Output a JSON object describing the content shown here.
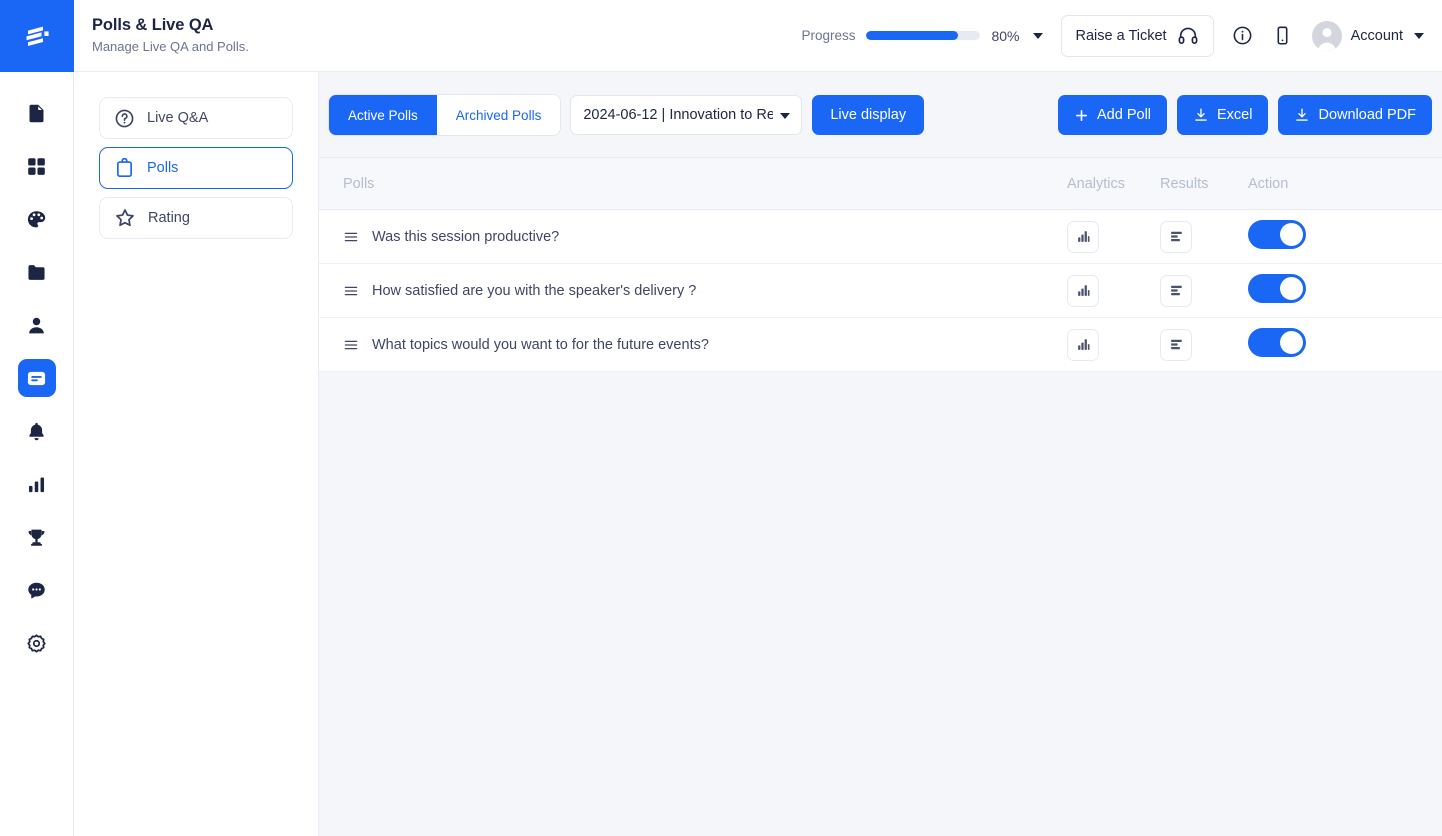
{
  "brand": {
    "logo_icon": "stacked-bars-logo",
    "accent_color": "#1a66f5"
  },
  "header": {
    "title": "Polls & Live QA",
    "subtitle": "Manage Live QA and Polls.",
    "progress": {
      "label": "Progress",
      "percent_text": "80%",
      "percent_value": 80,
      "caret_icon": "chevron-down-icon"
    },
    "raise_ticket": {
      "label": "Raise a Ticket",
      "icon": "headset-icon"
    },
    "info_icon": "info-circle-icon",
    "mobile_icon": "mobile-device-icon",
    "account": {
      "label": "Account",
      "avatar_icon": "user-avatar-icon",
      "caret_icon": "chevron-down-icon"
    }
  },
  "rail": {
    "items": [
      {
        "icon": "document-icon",
        "name": "document",
        "active": false
      },
      {
        "icon": "grid-icon",
        "name": "dashboard",
        "active": false
      },
      {
        "icon": "palette-icon",
        "name": "branding",
        "active": false
      },
      {
        "icon": "folder-icon",
        "name": "files",
        "active": false
      },
      {
        "icon": "user-icon",
        "name": "attendees",
        "active": false
      },
      {
        "icon": "polls-icon",
        "name": "polls",
        "active": true
      },
      {
        "icon": "bell-icon",
        "name": "notifications",
        "active": false
      },
      {
        "icon": "bar-chart-icon",
        "name": "analytics",
        "active": false
      },
      {
        "icon": "trophy-icon",
        "name": "gamification",
        "active": false
      },
      {
        "icon": "chat-icon",
        "name": "chat",
        "active": false
      },
      {
        "icon": "gear-icon",
        "name": "settings",
        "active": false
      }
    ]
  },
  "subnav": {
    "items": [
      {
        "label": "Live Q&A",
        "icon": "question-circle-icon",
        "active": false
      },
      {
        "label": "Polls",
        "icon": "clipboard-icon",
        "active": true
      },
      {
        "label": "Rating",
        "icon": "star-icon",
        "active": false
      }
    ]
  },
  "toolbar": {
    "tabs": [
      {
        "label": "Active Polls",
        "active": true
      },
      {
        "label": "Archived Polls",
        "active": false
      }
    ],
    "session_select": {
      "value": "2024-06-12 | Innovation to Re",
      "options": [
        "2024-06-12 | Innovation to Re"
      ]
    },
    "live_display_label": "Live display",
    "add_poll": {
      "label": "Add Poll",
      "icon": "plus-icon"
    },
    "excel": {
      "label": "Excel",
      "icon": "download-icon"
    },
    "download_pdf": {
      "label": "Download PDF",
      "icon": "download-icon"
    }
  },
  "table": {
    "columns": {
      "polls": "Polls",
      "analytics": "Analytics",
      "results": "Results",
      "action": "Action"
    },
    "rows": [
      {
        "question": "Was this session productive?",
        "drag_icon": "drag-handle-icon",
        "analytics_icon": "vertical-bar-chart-icon",
        "results_icon": "horizontal-bar-chart-icon",
        "enabled": true
      },
      {
        "question": "How satisfied are you with the speaker's delivery ?",
        "drag_icon": "drag-handle-icon",
        "analytics_icon": "vertical-bar-chart-icon",
        "results_icon": "horizontal-bar-chart-icon",
        "enabled": true
      },
      {
        "question": "What topics would you want to for the future events?",
        "drag_icon": "drag-handle-icon",
        "analytics_icon": "vertical-bar-chart-icon",
        "results_icon": "horizontal-bar-chart-icon",
        "enabled": true
      }
    ]
  }
}
